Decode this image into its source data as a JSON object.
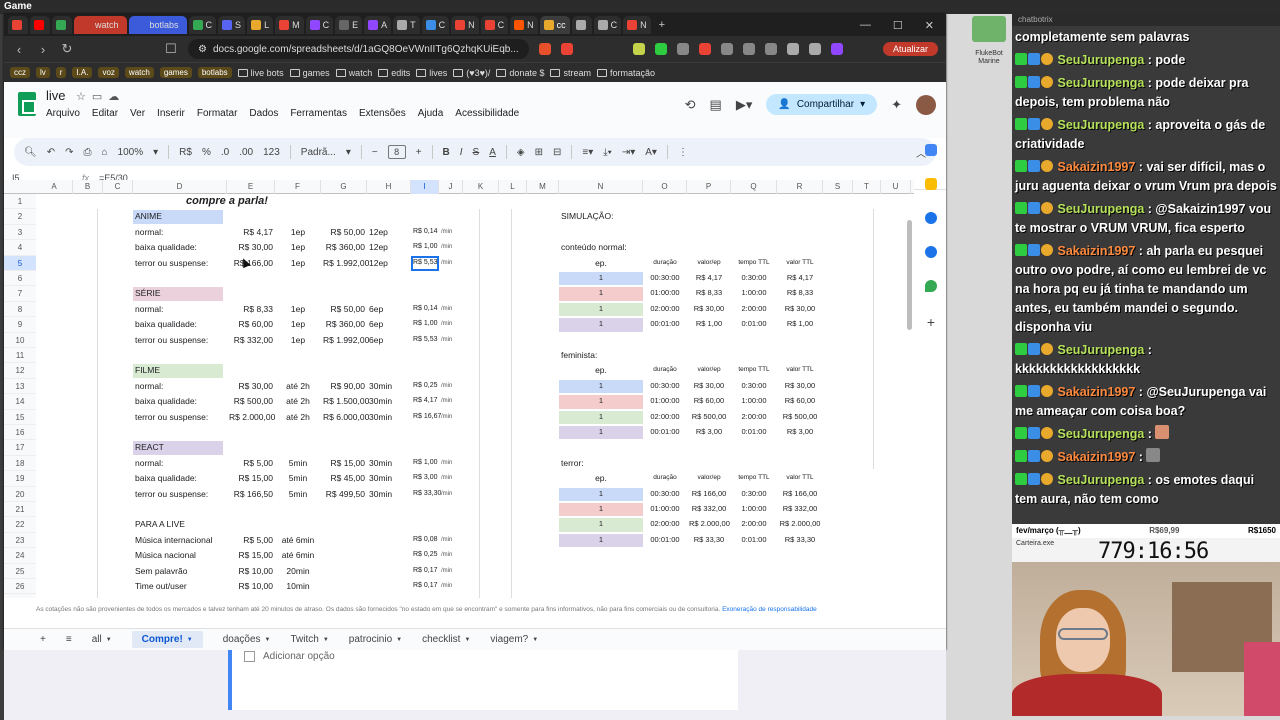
{
  "obs": {
    "title": "Game"
  },
  "chrome": {
    "tabs": [
      {
        "label": "",
        "color": "#ea4335"
      },
      {
        "label": "",
        "color": "#ff0000"
      },
      {
        "label": "",
        "color": "#34a853"
      },
      {
        "label": "watch",
        "color": "#c0392b"
      },
      {
        "label": "botlabs",
        "color": "#3b5bdb"
      },
      {
        "label": "C",
        "color": "#34a853"
      },
      {
        "label": "S",
        "color": "#5865f2"
      },
      {
        "label": "L",
        "color": "#e8a92c"
      },
      {
        "label": "M",
        "color": "#ea4335"
      },
      {
        "label": "C",
        "color": "#9146ff"
      },
      {
        "label": "E",
        "color": "#666666"
      },
      {
        "label": "A",
        "color": "#9146ff"
      },
      {
        "label": "T",
        "color": "#aaaaaa"
      },
      {
        "label": "C",
        "color": "#3a8ee6"
      },
      {
        "label": "N",
        "color": "#ea4335"
      },
      {
        "label": "C",
        "color": "#ea4335"
      },
      {
        "label": "N",
        "color": "#ff5500"
      },
      {
        "label": "cc",
        "color": "#e8a92c"
      },
      {
        "label": "",
        "color": "#aaaaaa"
      },
      {
        "label": "C",
        "color": "#aaaaaa"
      },
      {
        "label": "N",
        "color": "#ea4335"
      }
    ],
    "url": "docs.google.com/spreadsheets/d/1aGQ8OeVWnIITg6QzhqKUiEqb...",
    "update_label": "Atualizar",
    "bookmarks": [
      "ccz",
      "lv",
      "r",
      "I.A.",
      "voz",
      "watch",
      "games",
      "botlabs",
      "live bots",
      "games",
      "watch",
      "edits",
      "lives",
      "(♥3♥)/",
      "donate $",
      "stream",
      "formatação"
    ]
  },
  "sheets": {
    "doc_title": "live",
    "menu": [
      "Arquivo",
      "Editar",
      "Ver",
      "Inserir",
      "Formatar",
      "Dados",
      "Ferramentas",
      "Extensões",
      "Ajuda",
      "Acessibilidade"
    ],
    "share_label": "Compartilhar",
    "toolbar": {
      "zoom": "100%",
      "currency": "R$",
      "percent": "%",
      "dec_less": ".0",
      "dec_more": ".00",
      "number_format": "123",
      "font": "Padrã...",
      "font_size": "8"
    },
    "cell_ref": "I5",
    "formula": "=E5/30",
    "columns": [
      "A",
      "B",
      "C",
      "D",
      "E",
      "F",
      "G",
      "H",
      "I",
      "J",
      "K",
      "L",
      "M",
      "N",
      "O",
      "P",
      "Q",
      "R",
      "S",
      "T",
      "U"
    ],
    "rows": [
      "1",
      "2",
      "3",
      "4",
      "5",
      "6",
      "7",
      "8",
      "9",
      "10",
      "11",
      "12",
      "13",
      "14",
      "15",
      "16",
      "17",
      "18",
      "19",
      "20",
      "21",
      "22",
      "23",
      "24",
      "25",
      "26",
      "27"
    ],
    "left_title": "compre a parla!",
    "sections": [
      {
        "name": "ANIME",
        "color": "#c9daf8",
        "rows": [
          [
            "normal:",
            "R$ 4,17",
            "1ep",
            "R$ 50,00",
            "12ep",
            "R$ 0,14",
            "/min"
          ],
          [
            "baixa qualidade:",
            "R$ 30,00",
            "1ep",
            "R$ 360,00",
            "12ep",
            "R$ 1,00",
            "/min"
          ],
          [
            "terror ou suspense:",
            "R$ 166,00",
            "1ep",
            "R$ 1.992,00",
            "12ep",
            "R$ 5,53",
            "/min"
          ]
        ]
      },
      {
        "name": "SÉRIE",
        "color": "#ead1dc",
        "rows": [
          [
            "normal:",
            "R$ 8,33",
            "1ep",
            "R$ 50,00",
            "6ep",
            "R$ 0,14",
            "/min"
          ],
          [
            "baixa qualidade:",
            "R$ 60,00",
            "1ep",
            "R$ 360,00",
            "6ep",
            "R$ 1,00",
            "/min"
          ],
          [
            "terror ou suspense:",
            "R$ 332,00",
            "1ep",
            "R$ 1.992,00",
            "6ep",
            "R$ 5,53",
            "/min"
          ]
        ]
      },
      {
        "name": "FILME",
        "color": "#d9ead3",
        "rows": [
          [
            "normal:",
            "R$ 30,00",
            "até 2h",
            "R$ 90,00",
            "30min",
            "R$ 0,25",
            "/min"
          ],
          [
            "baixa qualidade:",
            "R$ 500,00",
            "até 2h",
            "R$ 1.500,00",
            "30min",
            "R$ 4,17",
            "/min"
          ],
          [
            "terror ou suspense:",
            "R$ 2.000,00",
            "até 2h",
            "R$ 6.000,00",
            "30min",
            "R$ 16,67",
            "/min"
          ]
        ]
      },
      {
        "name": "REACT",
        "color": "#d9d2e9",
        "rows": [
          [
            "normal:",
            "R$ 5,00",
            "5min",
            "R$ 15,00",
            "30min",
            "R$ 1,00",
            "/min"
          ],
          [
            "baixa qualidade:",
            "R$ 15,00",
            "5min",
            "R$ 45,00",
            "30min",
            "R$ 3,00",
            "/min"
          ],
          [
            "terror ou suspense:",
            "R$ 166,50",
            "5min",
            "R$ 499,50",
            "30min",
            "R$ 33,30",
            "/min"
          ]
        ]
      },
      {
        "name": "PARA A LIVE",
        "color": "#ffffff",
        "rows": [
          [
            "Música internacional",
            "R$ 5,00",
            "até 6min",
            "",
            "",
            "R$ 0,08",
            "/min"
          ],
          [
            "Música nacional",
            "R$ 15,00",
            "até 6min",
            "",
            "",
            "R$ 0,25",
            "/min"
          ],
          [
            "Sem palavrão",
            "R$ 10,00",
            "20min",
            "",
            "",
            "R$ 0,17",
            "/min"
          ],
          [
            "Time out/user",
            "R$ 10,00",
            "10min",
            "",
            "",
            "R$ 0,17",
            "/min"
          ]
        ]
      }
    ],
    "sim": {
      "title": "SIMULAÇÃO:",
      "headers": [
        "ep.",
        "duração",
        "valor/ep",
        "tempo TTL",
        "valor TTL"
      ],
      "groups": [
        {
          "label": "conteúdo normal:",
          "rows": [
            [
              "1",
              "00:30:00",
              "R$ 4,17",
              "0:30:00",
              "R$ 4,17"
            ],
            [
              "1",
              "01:00:00",
              "R$ 8,33",
              "1:00:00",
              "R$ 8,33"
            ],
            [
              "1",
              "02:00:00",
              "R$ 30,00",
              "2:00:00",
              "R$ 30,00"
            ],
            [
              "1",
              "00:01:00",
              "R$ 1,00",
              "0:01:00",
              "R$ 1,00"
            ]
          ]
        },
        {
          "label": "feminista:",
          "rows": [
            [
              "1",
              "00:30:00",
              "R$ 30,00",
              "0:30:00",
              "R$ 30,00"
            ],
            [
              "1",
              "01:00:00",
              "R$ 60,00",
              "1:00:00",
              "R$ 60,00"
            ],
            [
              "1",
              "02:00:00",
              "R$ 500,00",
              "2:00:00",
              "R$ 500,00"
            ],
            [
              "1",
              "00:01:00",
              "R$ 3,00",
              "0:01:00",
              "R$ 3,00"
            ]
          ]
        },
        {
          "label": "terror:",
          "rows": [
            [
              "1",
              "00:30:00",
              "R$ 166,00",
              "0:30:00",
              "R$ 166,00"
            ],
            [
              "1",
              "01:00:00",
              "R$ 332,00",
              "1:00:00",
              "R$ 332,00"
            ],
            [
              "1",
              "02:00:00",
              "R$ 2.000,00",
              "2:00:00",
              "R$ 2.000,00"
            ],
            [
              "1",
              "00:01:00",
              "R$ 33,30",
              "0:01:00",
              "R$ 33,30"
            ]
          ]
        }
      ],
      "row_colors": [
        "#c9daf8",
        "#f4cccc",
        "#d9ead3",
        "#d9d2e9"
      ]
    },
    "disclaimer": "As cotações não são provenientes de todos os mercados e talvez tenham até 20 minutos de atraso. Os dados são fornecidos \"no estado em que se encontram\" e somente para fins informativos, não para fins comerciais ou de consultoria.",
    "disclaimer_link": "Exoneração de responsabilidade",
    "sheet_tabs": [
      "all",
      "Compre!",
      "doações",
      "Twitch",
      "patrocinio",
      "checklist",
      "viagem?"
    ],
    "active_tab": "Compre!"
  },
  "form": {
    "option_label": "Adicionar opção"
  },
  "chat": {
    "title": "chatbotrix",
    "bot_label": "FlukeBot Marine",
    "messages": [
      {
        "user": "",
        "text": "completamente sem palavras",
        "cont": true
      },
      {
        "user": "SeuJurupenga",
        "text": "pode"
      },
      {
        "user": "SeuJurupenga",
        "text": "pode deixar pra depois, tem problema não"
      },
      {
        "user": "SeuJurupenga",
        "text": "aproveita o gás de criatividade"
      },
      {
        "user": "Sakaizin1997",
        "text": "vai ser difícil, mas o juru aguenta deixar o vrum Vrum pra depois"
      },
      {
        "user": "SeuJurupenga",
        "text": "@Sakaizin1997 vou te mostrar o VRUM VRUM, fica esperto"
      },
      {
        "user": "Sakaizin1997",
        "text": "ah parla eu pesquei outro ovo podre, aí como eu lembrei de vc na hora pq eu já tinha te mandando um antes, eu também mandei o segundo. disponha viu"
      },
      {
        "user": "SeuJurupenga",
        "text": "kkkkkkkkkkkkkkkkkk"
      },
      {
        "user": "Sakaizin1997",
        "text": "@SeuJurupenga vai me ameaçar com coisa boa?"
      },
      {
        "user": "SeuJurupenga",
        "text": ""
      },
      {
        "user": "Sakaizin1997",
        "text": ""
      },
      {
        "user": "SeuJurupenga",
        "text": "os emotes daqui tem aura, não tem como"
      }
    ]
  },
  "overlay": {
    "goal_left": "fev/março (╥﹏╥)",
    "goal_mid": "R$69,99",
    "goal_right": "R$1650",
    "timer_label": "Carteira.exe",
    "timer_value": "779:16:56"
  }
}
